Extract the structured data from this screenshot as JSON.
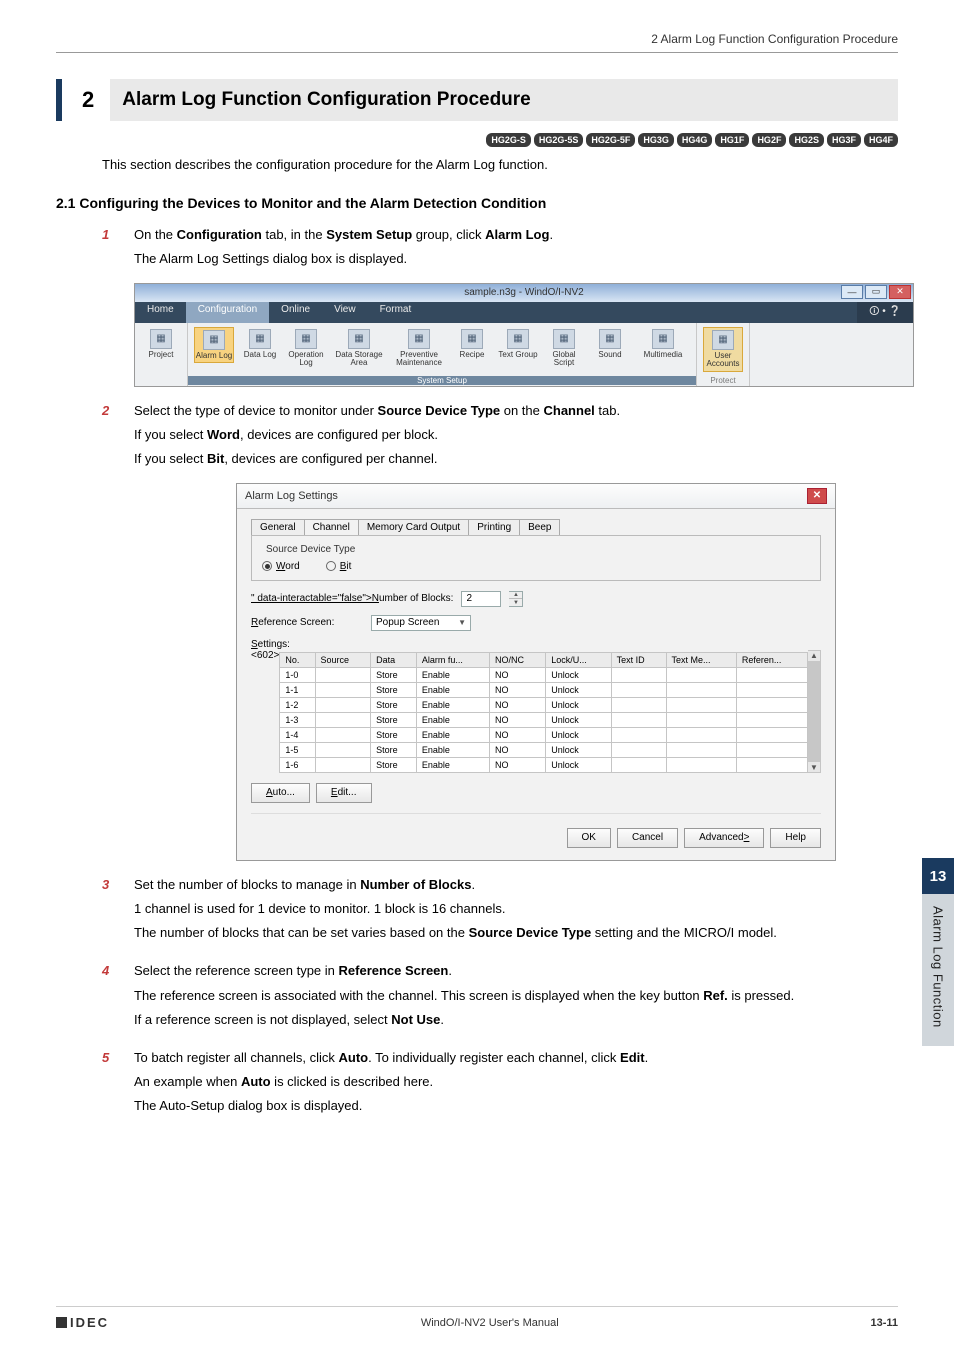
{
  "header": {
    "breadcrumb": "2 Alarm Log Function Configuration Procedure"
  },
  "section": {
    "number": "2",
    "title": "Alarm Log Function Configuration Procedure"
  },
  "badges": [
    "HG2G-S",
    "HG2G-5S",
    "HG2G-5F",
    "HG3G",
    "HG4G",
    "HG1F",
    "HG2F",
    "HG2S",
    "HG3F",
    "HG4F"
  ],
  "intro": "This section describes the configuration procedure for the Alarm Log function.",
  "subsection": "2.1   Configuring the Devices to Monitor and the Alarm Detection Condition",
  "steps": {
    "s1": {
      "num": "1",
      "line1_a": "On the ",
      "line1_b": "Configuration",
      "line1_c": " tab, in the ",
      "line1_d": "System Setup",
      "line1_e": " group, click ",
      "line1_f": "Alarm Log",
      "line1_g": ".",
      "line2": "The Alarm Log Settings dialog box is displayed."
    },
    "s2": {
      "num": "2",
      "line1_a": "Select the type of device to monitor under ",
      "line1_b": "Source Device Type",
      "line1_c": " on the ",
      "line1_d": "Channel",
      "line1_e": " tab.",
      "line2_a": "If you select ",
      "line2_b": "Word",
      "line2_c": ", devices are configured per block.",
      "line3_a": "If you select ",
      "line3_b": "Bit",
      "line3_c": ", devices are configured per channel."
    },
    "s3": {
      "num": "3",
      "line1_a": "Set the number of blocks to manage in ",
      "line1_b": "Number of Blocks",
      "line1_c": ".",
      "line2": "1 channel is used for 1 device to monitor. 1 block is 16 channels.",
      "line3_a": "The number of blocks that can be set varies based on the ",
      "line3_b": "Source Device Type",
      "line3_c": " setting and the MICRO/I model."
    },
    "s4": {
      "num": "4",
      "line1_a": "Select the reference screen type in ",
      "line1_b": "Reference Screen",
      "line1_c": ".",
      "line2_a": "The reference screen is associated with the channel. This screen is displayed when the key button ",
      "line2_b": "Ref.",
      "line2_c": " is pressed.",
      "line3_a": "If a reference screen is not displayed, select ",
      "line3_b": "Not Use",
      "line3_c": "."
    },
    "s5": {
      "num": "5",
      "line1_a": "To batch register all channels, click ",
      "line1_b": "Auto",
      "line1_c": ". To individually register each channel, click ",
      "line1_d": "Edit",
      "line1_e": ".",
      "line2_a": "An example when ",
      "line2_b": "Auto",
      "line2_c": " is clicked is described here.",
      "line3": "The Auto-Setup dialog box is displayed."
    }
  },
  "ribbon": {
    "window_title": "sample.n3g - WindO/I-NV2",
    "tabs": [
      "Home",
      "Configuration",
      "Online",
      "View",
      "Format"
    ],
    "active_tab_index": 1,
    "items": [
      {
        "label": "Project",
        "group": 0,
        "wide": false
      },
      {
        "label": "Alarm Log",
        "group": 1,
        "highlight": true,
        "wide": false
      },
      {
        "label": "Data Log",
        "group": 1,
        "wide": false
      },
      {
        "label": "Operation Log",
        "group": 1,
        "wide": false
      },
      {
        "label": "Data Storage Area",
        "group": 1,
        "wide": true
      },
      {
        "label": "Preventive Maintenance",
        "group": 1,
        "wide": true
      },
      {
        "label": "Recipe",
        "group": 1,
        "wide": false
      },
      {
        "label": "Text Group",
        "group": 1,
        "wide": false
      },
      {
        "label": "Global Script",
        "group": 1,
        "wide": false
      },
      {
        "label": "Sound",
        "group": 1,
        "wide": false
      },
      {
        "label": "Multimedia",
        "group": 1,
        "wide": true
      },
      {
        "label": "User Accounts",
        "group": 2,
        "hluser": true,
        "wide": false
      }
    ],
    "group_labels": [
      "",
      "System Setup",
      "Protect"
    ]
  },
  "dialog": {
    "title": "Alarm Log Settings",
    "tabs": [
      "General",
      "Channel",
      "Memory Card Output",
      "Printing",
      "Beep"
    ],
    "active_tab_index": 1,
    "fieldset_legend": "Source Device Type",
    "radio_word": "Word",
    "radio_bit": "Bit",
    "num_blocks_label": "Number of Blocks:",
    "num_blocks_value": "2",
    "ref_screen_label": "Reference Screen:",
    "ref_screen_value": "Popup Screen",
    "settings_label": "Settings:",
    "columns": [
      "No.",
      "Source",
      "Data",
      "Alarm fu...",
      "NO/NC",
      "Lock/U...",
      "Text ID",
      "Text Me...",
      "Referen..."
    ],
    "rows": [
      {
        "no": "1-0",
        "source": "",
        "data": "Store",
        "alarm": "Enable",
        "nonc": "NO",
        "lock": "Unlock",
        "tid": "",
        "tm": "",
        "ref": ""
      },
      {
        "no": "1-1",
        "source": "",
        "data": "Store",
        "alarm": "Enable",
        "nonc": "NO",
        "lock": "Unlock",
        "tid": "",
        "tm": "",
        "ref": ""
      },
      {
        "no": "1-2",
        "source": "",
        "data": "Store",
        "alarm": "Enable",
        "nonc": "NO",
        "lock": "Unlock",
        "tid": "",
        "tm": "",
        "ref": ""
      },
      {
        "no": "1-3",
        "source": "",
        "data": "Store",
        "alarm": "Enable",
        "nonc": "NO",
        "lock": "Unlock",
        "tid": "",
        "tm": "",
        "ref": ""
      },
      {
        "no": "1-4",
        "source": "",
        "data": "Store",
        "alarm": "Enable",
        "nonc": "NO",
        "lock": "Unlock",
        "tid": "",
        "tm": "",
        "ref": ""
      },
      {
        "no": "1-5",
        "source": "",
        "data": "Store",
        "alarm": "Enable",
        "nonc": "NO",
        "lock": "Unlock",
        "tid": "",
        "tm": "",
        "ref": ""
      },
      {
        "no": "1-6",
        "source": "",
        "data": "Store",
        "alarm": "Enable",
        "nonc": "NO",
        "lock": "Unlock",
        "tid": "",
        "tm": "",
        "ref": ""
      }
    ],
    "btn_auto": "Auto...",
    "btn_edit": "Edit...",
    "btn_ok": "OK",
    "btn_cancel": "Cancel",
    "btn_advanced": "Advanced >",
    "btn_help": "Help"
  },
  "side_tab": {
    "number": "13",
    "label": "Alarm Log Function"
  },
  "footer": {
    "logo": "IDEC",
    "center": "WindO/I-NV2 User's Manual",
    "right": "13-11"
  }
}
